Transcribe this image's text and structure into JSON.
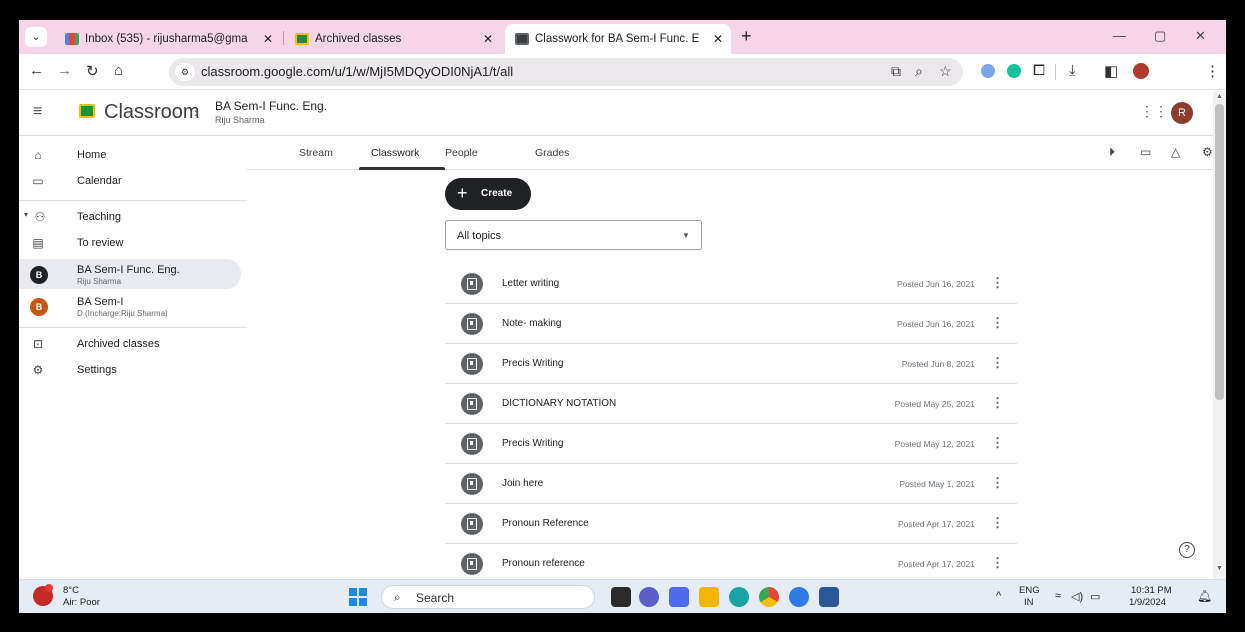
{
  "browser": {
    "tabs": [
      {
        "title": "Inbox (535) - rijusharma5@gma",
        "close": "✕"
      },
      {
        "title": "Archived classes",
        "close": "✕"
      },
      {
        "title": "Classwork for BA Sem-I Func. E",
        "close": "✕"
      }
    ],
    "tab_menu_icon": "chevron-down-icon",
    "new_tab": "+",
    "window_controls": {
      "minimize": "—",
      "restore": "▢",
      "close": "✕"
    },
    "url": "classroom.google.com/u/1/w/MjI5MDQyODI0NjA1/t/all",
    "toolbar_icons": [
      "back-icon",
      "forward-icon",
      "reload-icon",
      "home-icon",
      "site-info-icon",
      "cast-icon",
      "zoom-icon",
      "star-icon",
      "extension-icon",
      "grammarly-icon",
      "puzzle-icon",
      "download-icon",
      "sidepanel-icon",
      "profile-icon",
      "menu-icon"
    ]
  },
  "app": {
    "name": "Classroom",
    "class_name": "BA Sem-I Func. Eng.",
    "class_teacher": "Riju Sharma",
    "avatar_letter": "R"
  },
  "sidebar": {
    "items": [
      {
        "label": "Home",
        "icon": "home-icon"
      },
      {
        "label": "Calendar",
        "icon": "calendar-icon"
      },
      {
        "label": "Teaching",
        "icon": "people-icon"
      },
      {
        "label": "To review",
        "icon": "review-icon"
      },
      {
        "label": "BA Sem-I Func. Eng.",
        "sub": "Riju Sharma",
        "avatar": "B",
        "color": "#202124"
      },
      {
        "label": "BA Sem-I",
        "sub": "D (Incharge:Riju Sharma)",
        "avatar": "B",
        "color": "#c45811"
      },
      {
        "label": "Archived classes",
        "icon": "archive-icon"
      },
      {
        "label": "Settings",
        "icon": "gear-icon"
      }
    ]
  },
  "main": {
    "tabs": [
      "Stream",
      "Classwork",
      "People",
      "Grades"
    ],
    "active_tab": "Classwork",
    "create_label": "Create",
    "topic_filter": "All topics",
    "assignments": [
      {
        "title": "Letter writing",
        "posted": "Posted Jun 16, 2021"
      },
      {
        "title": "Note- making",
        "posted": "Posted Jun 16, 2021"
      },
      {
        "title": "Precis Writing",
        "posted": "Posted Jun 8, 2021"
      },
      {
        "title": "DICTIONARY NOTATION",
        "posted": "Posted May 25, 2021"
      },
      {
        "title": "Precis Writing",
        "posted": "Posted May 12, 2021"
      },
      {
        "title": "Join here",
        "posted": "Posted May 1, 2021"
      },
      {
        "title": "Pronoun Reference",
        "posted": "Posted Apr 17, 2021"
      },
      {
        "title": "Pronoun reference",
        "posted": "Posted Apr 17, 2021"
      }
    ]
  },
  "taskbar": {
    "weather_temp": "8°C",
    "weather_desc": "Air: Poor",
    "search_label": "Search",
    "lang_top": "ENG",
    "lang_bottom": "IN",
    "time": "10:31 PM",
    "date": "1/9/2024"
  }
}
